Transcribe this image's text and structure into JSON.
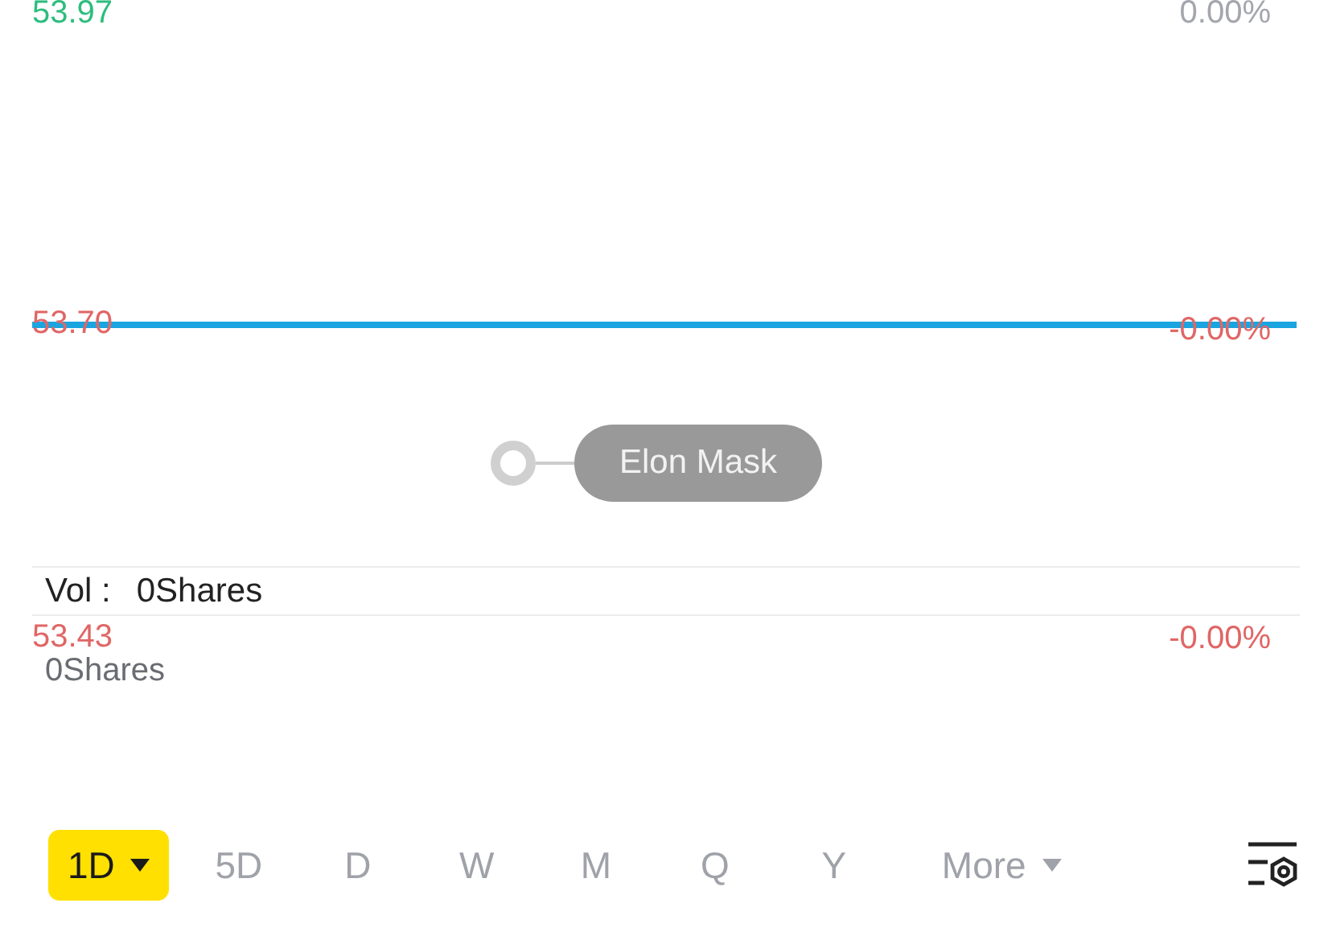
{
  "price_chart": {
    "high_price": {
      "text": "53.97",
      "color": "#2dbd7e"
    },
    "high_change": {
      "text": "0.00%",
      "color": "#a4a6ad"
    },
    "mid_price": {
      "text": "53.70",
      "color": "#e06666"
    },
    "mid_change": {
      "text": "-0.00%",
      "color": "#e06666"
    },
    "annotation": {
      "label": "Elon Mask"
    }
  },
  "volume": {
    "label": "Vol :",
    "value": "0Shares",
    "low_price": {
      "text": "53.43",
      "color": "#e06666"
    },
    "low_change": {
      "text": "-0.00%",
      "color": "#e06666"
    },
    "axis_value": "0Shares"
  },
  "periods": [
    {
      "label": "1D",
      "selected": true,
      "has_menu": true
    },
    {
      "label": "5D",
      "selected": false,
      "has_menu": false
    },
    {
      "label": "D",
      "selected": false,
      "has_menu": false
    },
    {
      "label": "W",
      "selected": false,
      "has_menu": false
    },
    {
      "label": "M",
      "selected": false,
      "has_menu": false
    },
    {
      "label": "Q",
      "selected": false,
      "has_menu": false
    },
    {
      "label": "Y",
      "selected": false,
      "has_menu": false
    },
    {
      "label": "More",
      "selected": false,
      "has_menu": true
    }
  ]
}
